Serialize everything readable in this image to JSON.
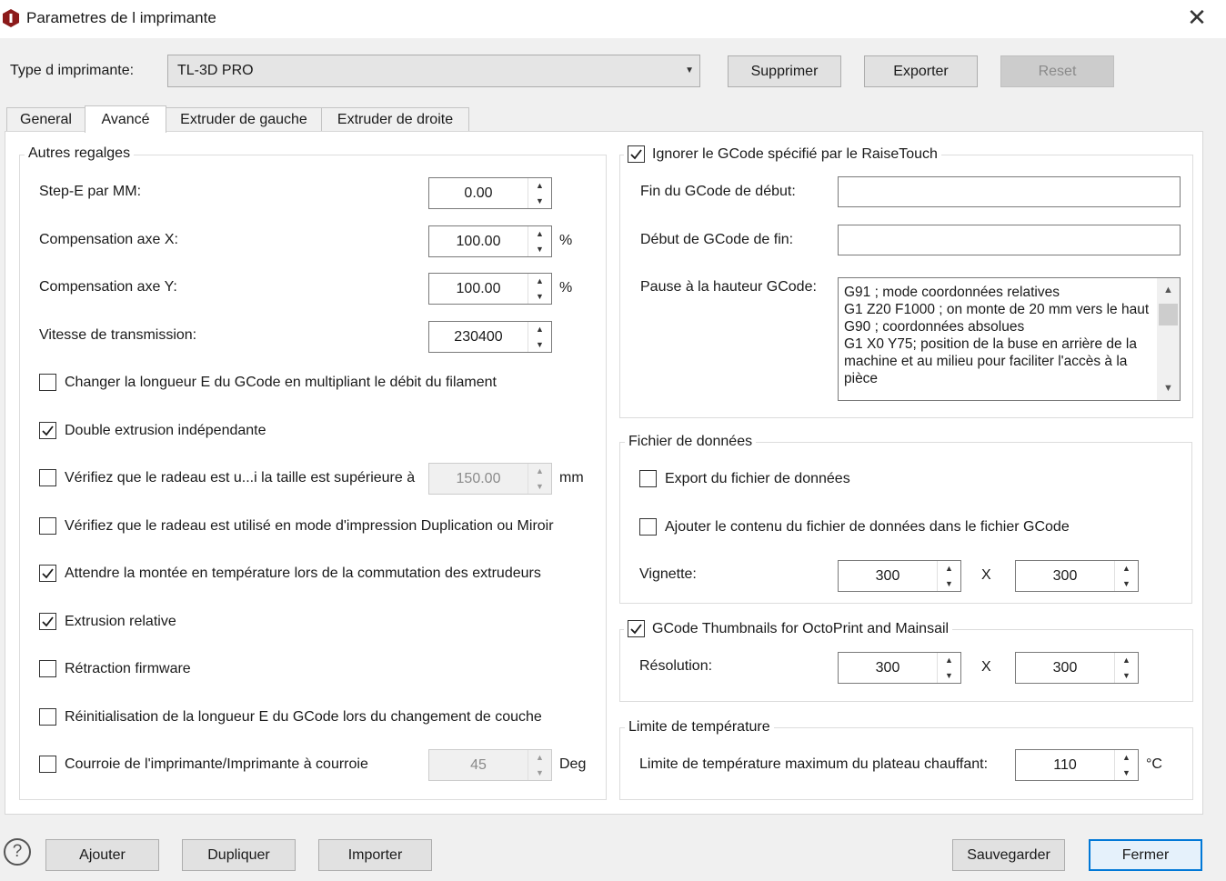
{
  "window": {
    "title": "Parametres de l imprimante",
    "close_glyph": "✕"
  },
  "printer": {
    "type_label": "Type d imprimante:",
    "selected": "TL-3D PRO",
    "delete_label": "Supprimer",
    "export_label": "Exporter",
    "reset_label": "Reset"
  },
  "tabs": [
    {
      "label": "General"
    },
    {
      "label": "Avancé"
    },
    {
      "label": "Extruder de gauche"
    },
    {
      "label": "Extruder de droite"
    }
  ],
  "left_group": {
    "title": "Autres regalges",
    "stepe": {
      "label": "Step-E par MM:",
      "value": "0.00"
    },
    "comp_x": {
      "label": "Compensation axe X:",
      "value": "100.00",
      "unit": "%"
    },
    "comp_y": {
      "label": "Compensation axe Y:",
      "value": "100.00",
      "unit": "%"
    },
    "baud": {
      "label": "Vitesse de transmission:",
      "value": "230400"
    },
    "checks": [
      {
        "label": "Changer la longueur E du GCode en multipliant le débit du filament",
        "checked": false
      },
      {
        "label": "Double extrusion indépendante",
        "checked": true
      },
      {
        "label": "Vérifiez que le radeau est u...i la taille est supérieure à",
        "checked": false
      },
      {
        "label": "Vérifiez que le radeau est utilisé en mode d'impression Duplication ou Miroir",
        "checked": false
      },
      {
        "label": "Attendre la montée en température lors de la commutation des extrudeurs",
        "checked": true
      },
      {
        "label": "Extrusion relative",
        "checked": true
      },
      {
        "label": "Rétraction firmware",
        "checked": false
      },
      {
        "label": "Réinitialisation de la longueur E du GCode lors du changement de couche",
        "checked": false
      },
      {
        "label": "Courroie de l'imprimante/Imprimante à courroie",
        "checked": false
      }
    ],
    "raft_size": {
      "value": "150.00",
      "unit": "mm"
    },
    "belt_angle": {
      "value": "45",
      "unit": "Deg"
    }
  },
  "raisetouch": {
    "title": "Ignorer le GCode spécifié par le RaiseTouch",
    "checked": true,
    "end_of_start_label": "Fin du GCode de début:",
    "end_of_start_value": "",
    "start_of_end_label": "Début de GCode de fin:",
    "start_of_end_value": "",
    "pause_label": "Pause à la hauteur GCode:",
    "pause_gcode": "G91 ; mode coordonnées relatives\nG1 Z20 F1000 ; on monte de 20 mm vers le haut\nG90 ; coordonnées absolues\nG1 X0 Y75; position de la buse en arrière de la machine et au milieu pour faciliter l'accès à la pièce"
  },
  "data_file": {
    "title": "Fichier de données",
    "export_label": "Export du fichier de données",
    "export_checked": false,
    "append_label": "Ajouter le contenu du fichier de données dans le fichier GCode",
    "append_checked": false,
    "vignette_label": "Vignette:",
    "width": "300",
    "x_sep": "X",
    "height": "300"
  },
  "thumbnails": {
    "title": "GCode Thumbnails for OctoPrint and Mainsail",
    "checked": true,
    "resolution_label": "Résolution:",
    "width": "300",
    "x_sep": "X",
    "height": "300"
  },
  "temp_limit": {
    "title": "Limite de température",
    "bed_label": "Limite de température maximum du plateau chauffant:",
    "bed_value": "110",
    "unit": "°C"
  },
  "footer": {
    "help_glyph": "?",
    "add_label": "Ajouter",
    "duplicate_label": "Dupliquer",
    "import_label": "Importer",
    "save_label": "Sauvegarder",
    "close_label": "Fermer"
  }
}
